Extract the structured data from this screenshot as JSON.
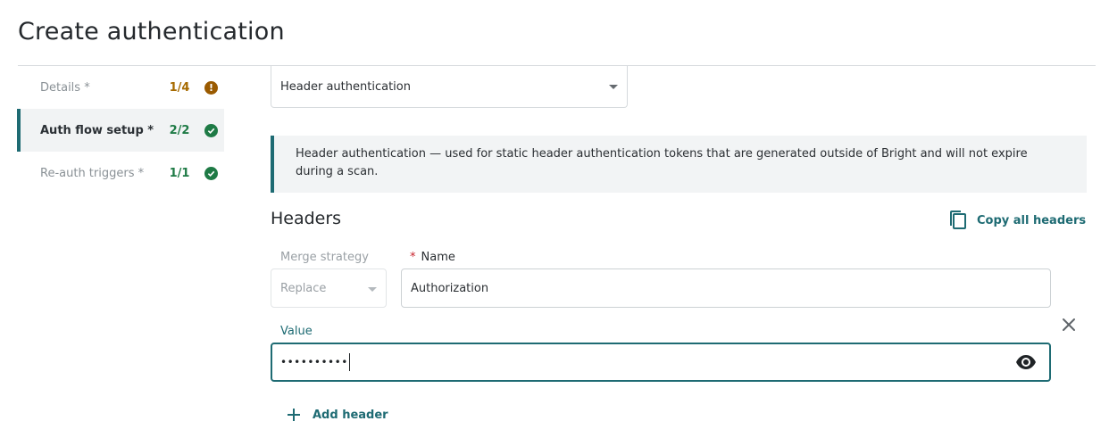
{
  "page": {
    "title": "Create authentication"
  },
  "stepper": {
    "steps": [
      {
        "label": "Details *",
        "count": "1/4",
        "status": "warning",
        "status_icon": "exclamation-icon",
        "active": false
      },
      {
        "label": "Auth flow setup *",
        "count": "2/2",
        "status": "complete",
        "status_icon": "check-icon",
        "active": true
      },
      {
        "label": "Re-auth triggers *",
        "count": "1/1",
        "status": "complete",
        "status_icon": "check-icon",
        "active": false
      }
    ]
  },
  "auth_type": {
    "selected": "Header authentication"
  },
  "info": {
    "text": "Header authentication — used for static header authentication tokens that are generated outside of Bright and will not expire during a scan."
  },
  "headers": {
    "title": "Headers",
    "copy_all_label": "Copy all headers",
    "merge_strategy_label": "Merge strategy",
    "merge_strategy_value": "Replace",
    "name_required_mark": "*",
    "name_label": "Name",
    "name_value": "Authorization",
    "value_label": "Value",
    "value_masked": "••••••••••",
    "add_header_label": "Add header"
  },
  "colors": {
    "accent": "#1e6b73",
    "warning": "#9a5a00",
    "success": "#1e7a45",
    "required": "#c8232c"
  }
}
